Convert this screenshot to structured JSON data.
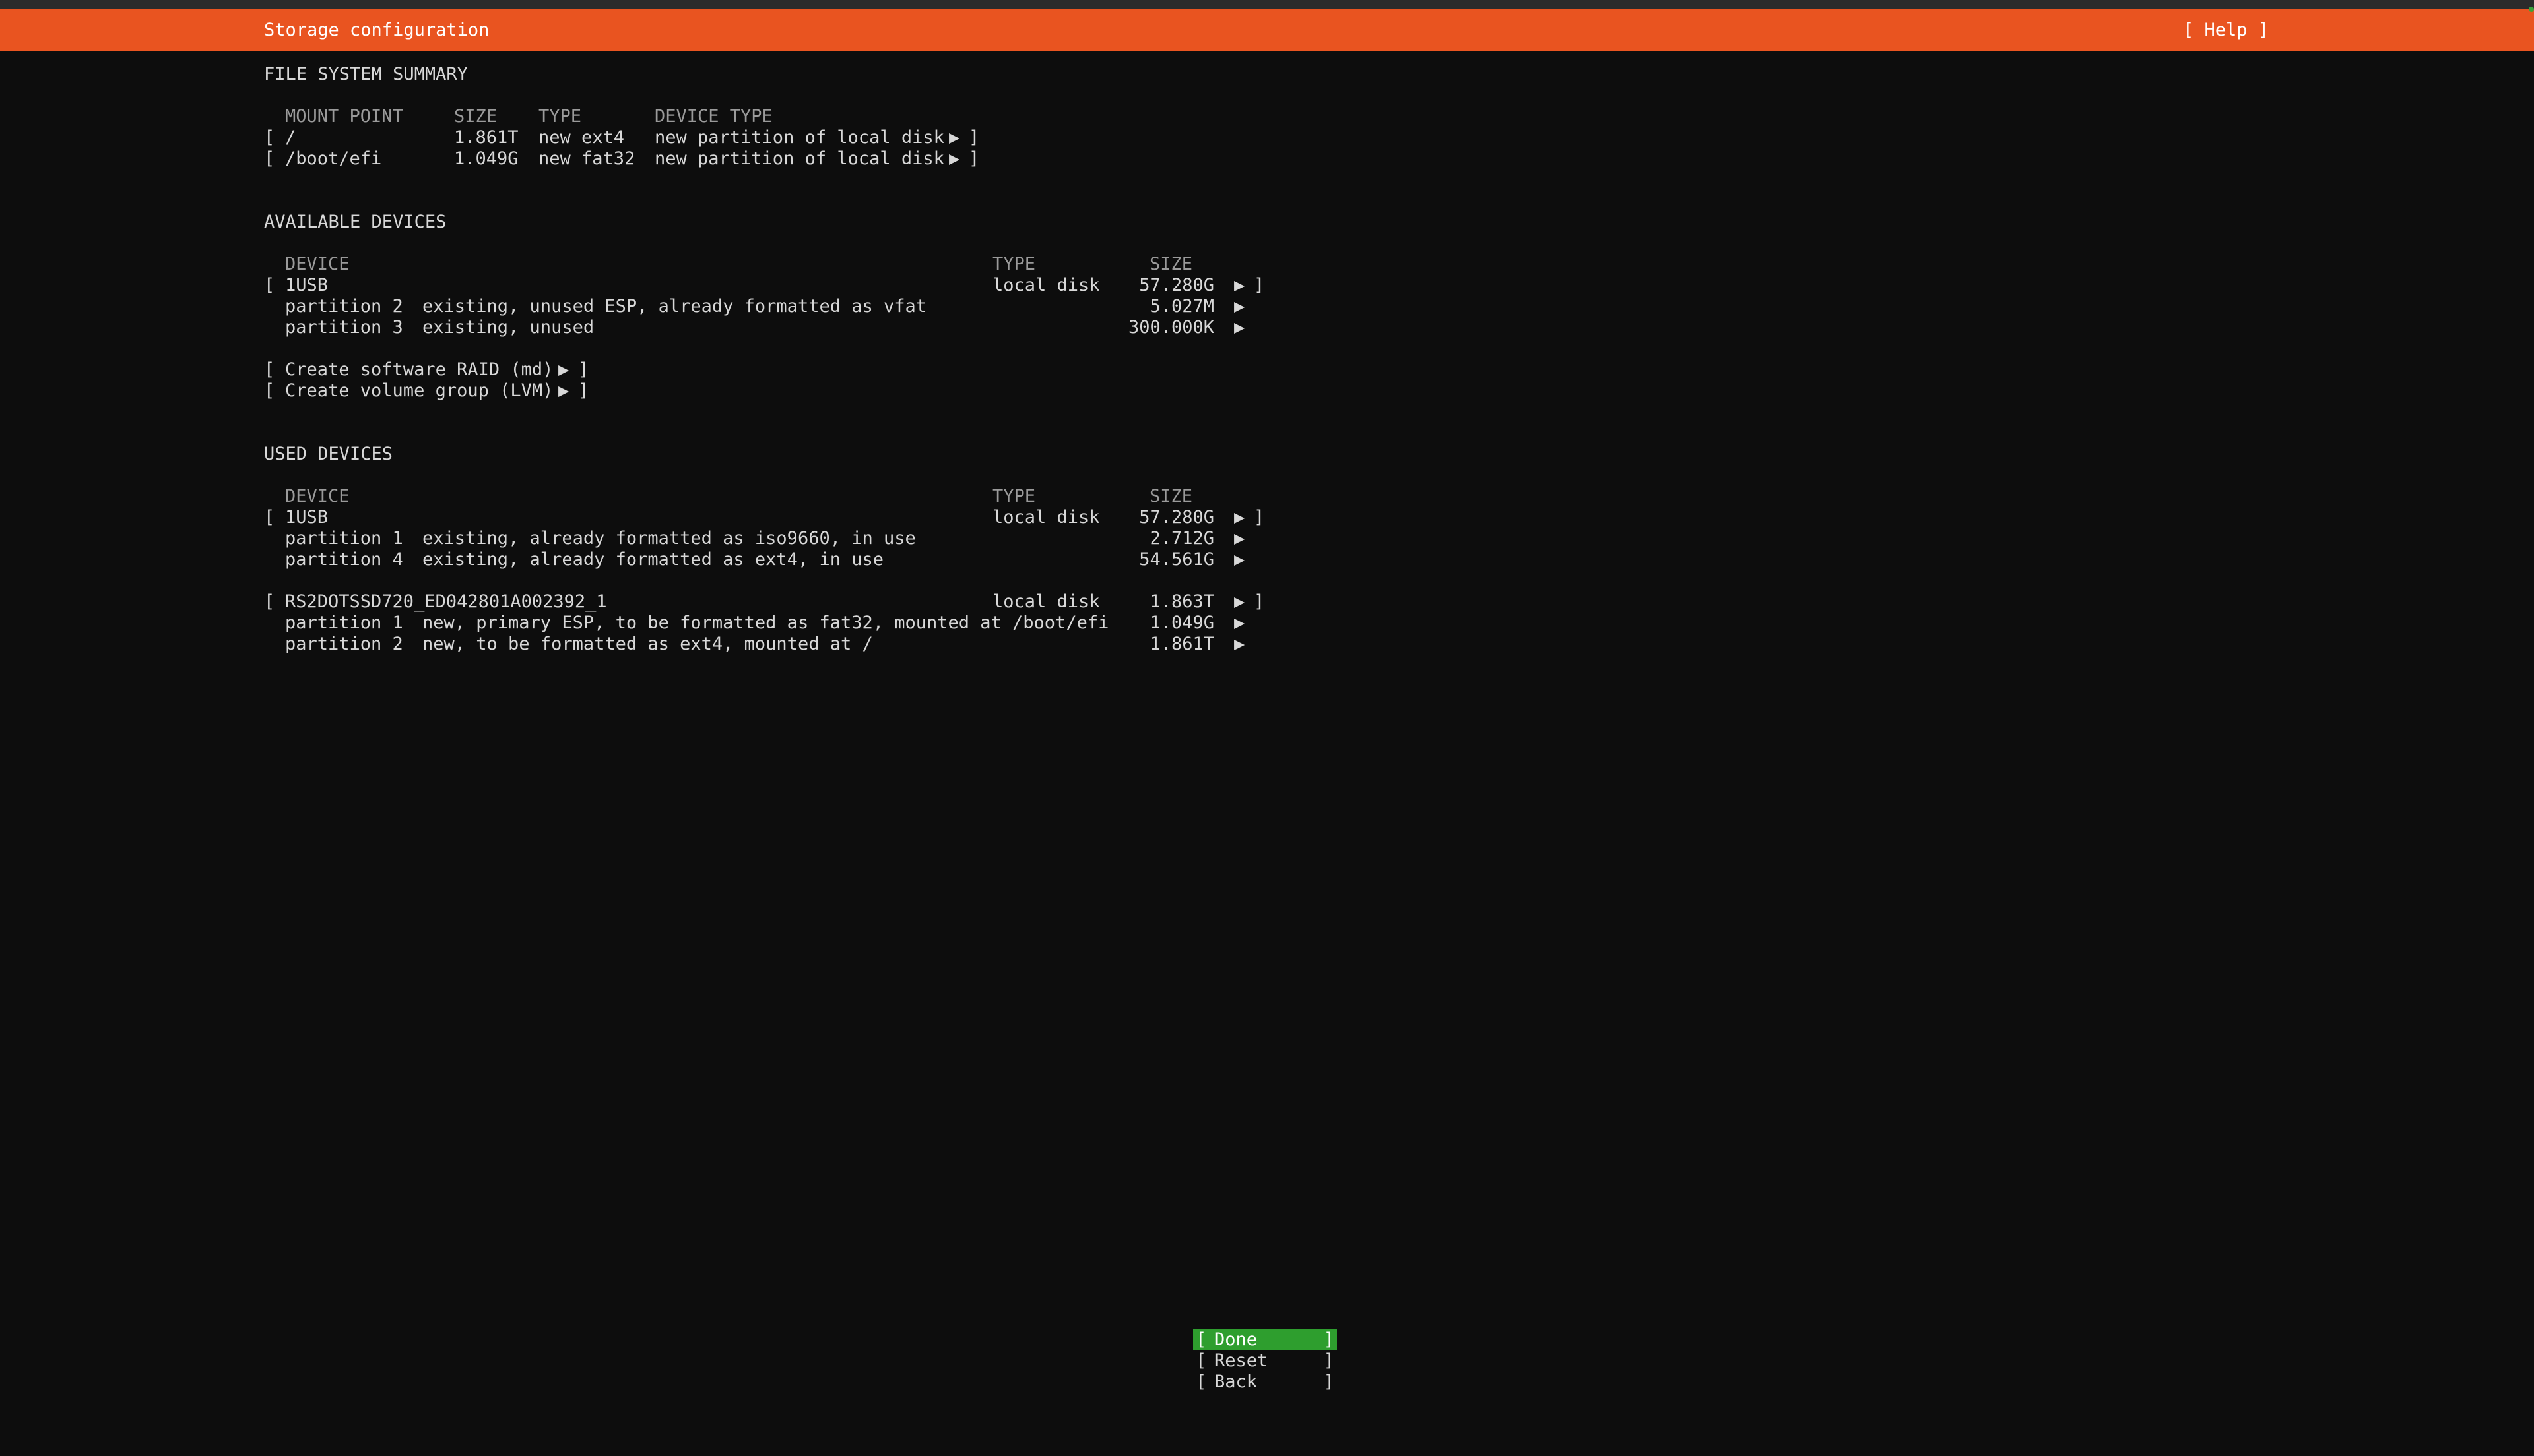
{
  "header": {
    "title": "Storage configuration",
    "help": "[ Help ]"
  },
  "fs_summary": {
    "heading": "FILE SYSTEM SUMMARY",
    "columns": {
      "mount": "MOUNT POINT",
      "size": "SIZE",
      "type": "TYPE",
      "device_type": "DEVICE TYPE"
    },
    "rows": [
      {
        "mount": "/",
        "size": "1.861T",
        "type": "new ext4",
        "device_type": "new partition of local disk"
      },
      {
        "mount": "/boot/efi",
        "size": "1.049G",
        "type": "new fat32",
        "device_type": "new partition of local disk"
      }
    ]
  },
  "available": {
    "heading": "AVAILABLE DEVICES",
    "columns": {
      "device": "DEVICE",
      "type": "TYPE",
      "size": "SIZE"
    },
    "disk": {
      "name": "1USB",
      "type": "local disk",
      "size": "57.280G"
    },
    "partitions": [
      {
        "name": "partition 2",
        "desc": "existing, unused ESP, already formatted as vfat",
        "size": "5.027M"
      },
      {
        "name": "partition 3",
        "desc": "existing, unused",
        "size": "300.000K"
      }
    ],
    "actions": [
      "Create software RAID (md)",
      "Create volume group (LVM)"
    ]
  },
  "used": {
    "heading": "USED DEVICES",
    "columns": {
      "device": "DEVICE",
      "type": "TYPE",
      "size": "SIZE"
    },
    "disk1": {
      "name": "1USB",
      "type": "local disk",
      "size": "57.280G"
    },
    "disk1_partitions": [
      {
        "name": "partition 1",
        "desc": "existing, already formatted as iso9660, in use",
        "size": "2.712G"
      },
      {
        "name": "partition 4",
        "desc": "existing, already formatted as ext4, in use",
        "size": "54.561G"
      }
    ],
    "disk2": {
      "name": "RS2DOTSSD720_ED042801A002392_1",
      "type": "local disk",
      "size": "1.863T"
    },
    "disk2_partitions": [
      {
        "name": "partition 1",
        "desc": "new, primary ESP, to be formatted as fat32, mounted at /boot/efi",
        "size": "1.049G"
      },
      {
        "name": "partition 2",
        "desc": "new, to be formatted as ext4, mounted at /",
        "size": "1.861T"
      }
    ]
  },
  "buttons": {
    "done": "Done",
    "reset": "Reset",
    "back": "Back"
  },
  "glyphs": {
    "arrow": "▶",
    "lbr": "[",
    "rbr": "]"
  },
  "colors": {
    "accent": "#e95420",
    "selected": "#2e9e2e",
    "background": "#0d0d0d",
    "text": "#d8d8d8"
  }
}
